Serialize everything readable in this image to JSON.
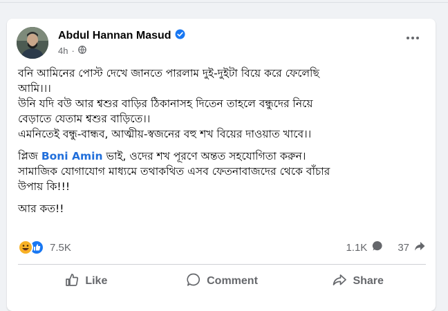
{
  "post": {
    "author": "Abdul Hannan Masud",
    "time": "4h",
    "paragraphs": [
      [
        "বনি আমিনের পোস্ট দেখে জানতে পারলাম দুই-দুইটা বিয়ে করে ফেলেছি",
        "আমি।।।",
        "উনি যদি বউ আর শ্বশুর বাড়ির ঠিকানাসহ দিতেন তাহলে বন্ধুদের নিয়ে",
        "বেড়াতে যেতাম শ্বশুর বাড়িতে।।",
        "এমনিতেই বন্ধু-বান্ধব, আত্মীয়-স্বজনের বহু শখ বিয়ের দাওয়াত খাবে।।"
      ],
      {
        "before": "প্লিজ ",
        "mention": "Boni Amin",
        "after": " ভাই, ওদের শখ পূরণে অন্তত সহযোগিতা করুন।",
        "rest": [
          "সামাজিক যোগাযোগ মাধ্যমে তথাকথিত এসব ফেতনাবাজদের থেকে বাঁচার",
          "উপায় কি!!!"
        ]
      },
      [
        "আর কত!!"
      ]
    ]
  },
  "stats": {
    "reactions": "7.5K",
    "comments": "1.1K",
    "shares": "37"
  },
  "actions": {
    "like": "Like",
    "comment": "Comment",
    "share": "Share"
  },
  "colors": {
    "link": "#216fdb",
    "verified": "#1877f2",
    "muted": "#65676b"
  },
  "icons": [
    "verified-badge-icon",
    "globe-icon",
    "more-options-icon",
    "haha-reaction-icon",
    "like-reaction-icon",
    "comment-icon",
    "share-icon",
    "like-icon"
  ]
}
